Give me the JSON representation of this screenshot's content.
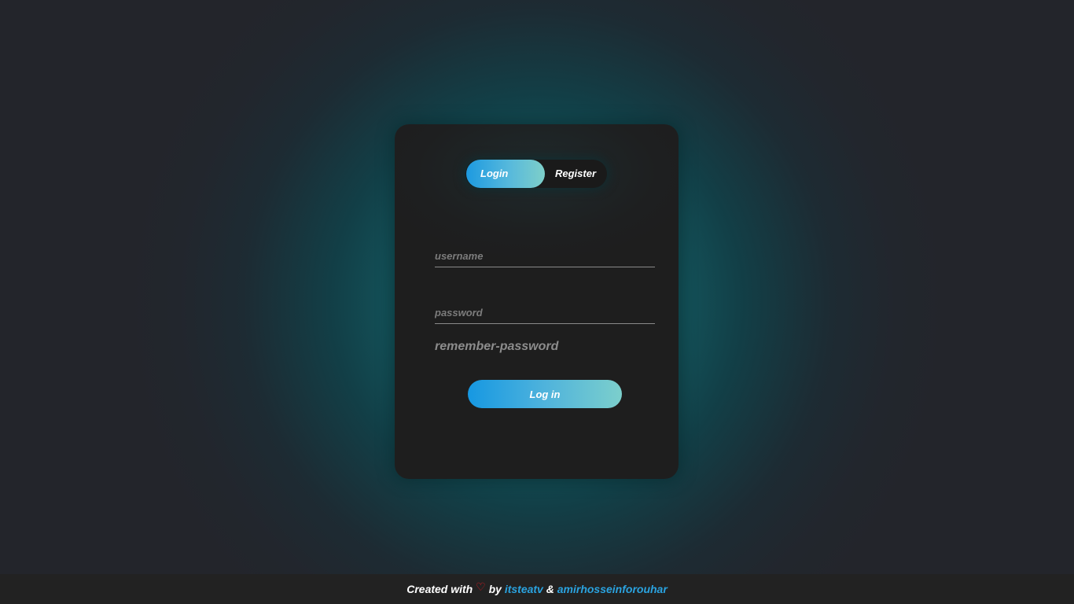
{
  "auth_card": {
    "tabs": {
      "login": "Login",
      "register": "Register",
      "active": "login"
    },
    "username": {
      "placeholder": "username",
      "value": ""
    },
    "password": {
      "placeholder": "password",
      "value": ""
    },
    "remember_label": "remember-password",
    "submit_label": "Log in"
  },
  "footer": {
    "created_with": "Created with",
    "heart_icon": "♡",
    "by": "by",
    "author1": "itsteatv",
    "ampersand": "&",
    "author2": "amirhosseinforouhar"
  },
  "colors": {
    "accent_start": "#1698e2",
    "accent_end": "#7ccfcc",
    "glow": "#176a70",
    "card_bg": "#1e1e1e",
    "link": "#2aa3e0",
    "heart": "#e31b23"
  }
}
